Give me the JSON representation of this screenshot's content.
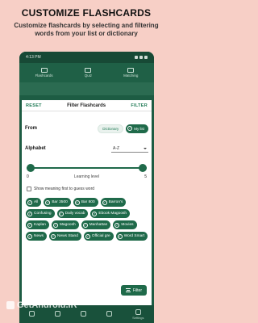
{
  "promo": {
    "title": "CUSTOMIZE FLASHCARDS",
    "subtitle": "Customize flashcards by selecting and filtering words from your list or dictionary"
  },
  "status": {
    "time": "4:13 PM"
  },
  "topnav": {
    "items": [
      "Flashcards",
      "Quiz",
      "Matching"
    ]
  },
  "sheet": {
    "reset_label": "RESET",
    "title": "Filter Flashcards",
    "filter_label": "FILTER",
    "from_label": "From",
    "from_options": [
      "Dictionary",
      "My list"
    ],
    "from_selected": "My list",
    "alphabet_label": "Alphabet",
    "alphabet_value": "A-Z",
    "level_min": "0",
    "level_max": "5",
    "level_caption": "Learning level",
    "level_range": [
      0,
      5
    ],
    "show_meaning_label": "Show meaning first to guess word",
    "tags": [
      "All",
      "Bar 3500",
      "Bar 800",
      "Barron's",
      "Confusing",
      "Daily vocab",
      "Ebook Magoosh",
      "Kaplan",
      "Magoosh",
      "Manhattan",
      "Movies",
      "News",
      "News Stand",
      "Official gre",
      "Word Smart"
    ]
  },
  "fab": {
    "label": "Filter"
  },
  "bottomnav": {
    "items": [
      "",
      "",
      "",
      "",
      "Settings"
    ]
  },
  "watermark": {
    "text": "GetAndroid.iR"
  },
  "colors": {
    "accent": "#1f6a4a",
    "background": "#f7cfc6"
  }
}
